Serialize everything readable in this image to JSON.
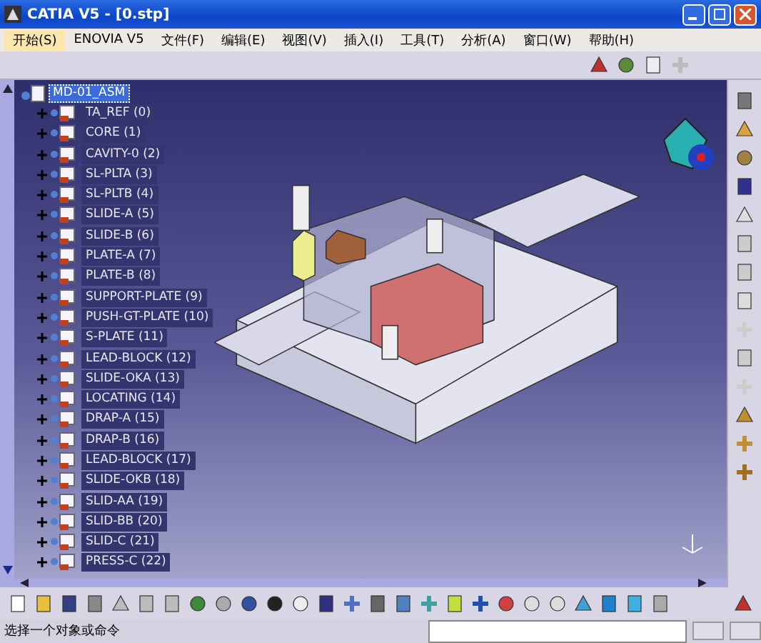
{
  "window": {
    "title": "CATIA V5 - [0.stp]"
  },
  "menu": [
    {
      "label": "开始(S)",
      "selected": true
    },
    {
      "label": "ENOVIA V5",
      "selected": false
    },
    {
      "label": "文件(F)",
      "selected": false
    },
    {
      "label": "编辑(E)",
      "selected": false
    },
    {
      "label": "视图(V)",
      "selected": false
    },
    {
      "label": "插入(I)",
      "selected": false
    },
    {
      "label": "工具(T)",
      "selected": false
    },
    {
      "label": "分析(A)",
      "selected": false
    },
    {
      "label": "窗口(W)",
      "selected": false
    },
    {
      "label": "帮助(H)",
      "selected": false
    }
  ],
  "tree": {
    "root": {
      "label": "MD-01_ASM",
      "selected": true
    },
    "children": [
      {
        "label": "TA_REF (0)",
        "selected": false
      },
      {
        "label": "CORE (1)",
        "selected": false
      },
      {
        "label": "CAVITY-0 (2)",
        "selected": false
      },
      {
        "label": "SL-PLTA (3)",
        "selected": false
      },
      {
        "label": "SL-PLTB (4)",
        "selected": false
      },
      {
        "label": "SLIDE-A (5)",
        "selected": false
      },
      {
        "label": "SLIDE-B (6)",
        "selected": false
      },
      {
        "label": "PLATE-A (7)",
        "selected": false
      },
      {
        "label": "PLATE-B (8)",
        "selected": false
      },
      {
        "label": "SUPPORT-PLATE (9)",
        "selected": false
      },
      {
        "label": "PUSH-GT-PLATE (10)",
        "selected": false
      },
      {
        "label": "S-PLATE (11)",
        "selected": false
      },
      {
        "label": "LEAD-BLOCK (12)",
        "selected": false
      },
      {
        "label": "SLIDE-OKA (13)",
        "selected": false
      },
      {
        "label": "LOCATING (14)",
        "selected": false
      },
      {
        "label": "DRAP-A (15)",
        "selected": false
      },
      {
        "label": "DRAP-B (16)",
        "selected": false
      },
      {
        "label": "LEAD-BLOCK (17)",
        "selected": false
      },
      {
        "label": "SLIDE-OKB (18)",
        "selected": false
      },
      {
        "label": "SLID-AA (19)",
        "selected": false
      },
      {
        "label": "SLID-BB (20)",
        "selected": false
      },
      {
        "label": "SLID-C (21)",
        "selected": false
      },
      {
        "label": "PRESS-C (22)",
        "selected": false
      }
    ]
  },
  "status_bar": {
    "message": "选择一个对象或命令"
  }
}
